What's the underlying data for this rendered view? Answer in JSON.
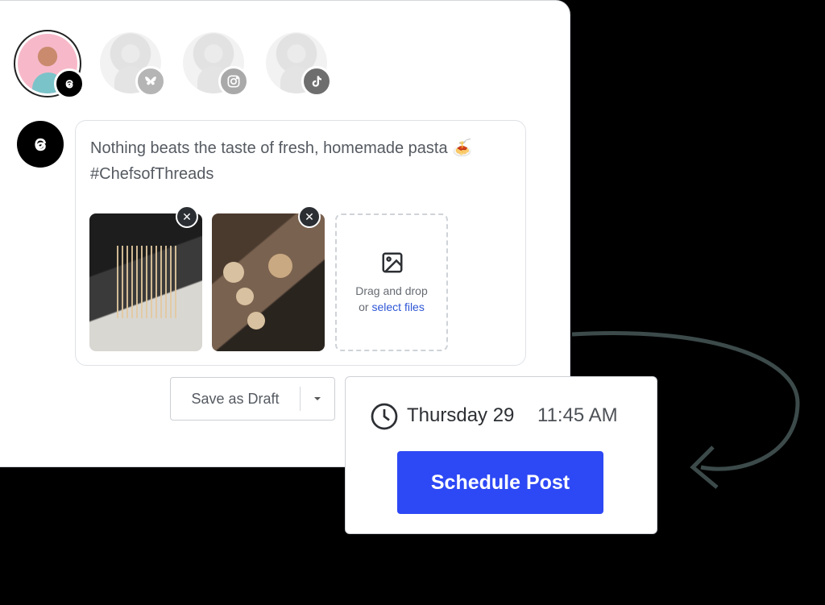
{
  "accounts": [
    {
      "name": "threads",
      "icon": "threads-icon",
      "badge_color": "#000000",
      "active": true
    },
    {
      "name": "bluesky",
      "icon": "butterfly-icon",
      "badge_color": "#b5b5b5",
      "active": false
    },
    {
      "name": "instagram",
      "icon": "instagram-icon",
      "badge_color": "#a9a9a9",
      "active": false
    },
    {
      "name": "tiktok",
      "icon": "tiktok-icon",
      "badge_color": "#6e6e6e",
      "active": false
    }
  ],
  "post": {
    "text_line1": "Nothing beats the taste of fresh, homemade pasta 🍝",
    "text_line2": "#ChefsofThreads"
  },
  "dropzone": {
    "line1": "Drag and drop",
    "line2_prefix": "or ",
    "line2_link": "select files"
  },
  "draft": {
    "label": "Save as Draft"
  },
  "schedule": {
    "date": "Thursday 29",
    "time": "11:45 AM",
    "button_label": "Schedule Post"
  },
  "colors": {
    "primary": "#2d48f5",
    "link": "#2e56d6"
  }
}
